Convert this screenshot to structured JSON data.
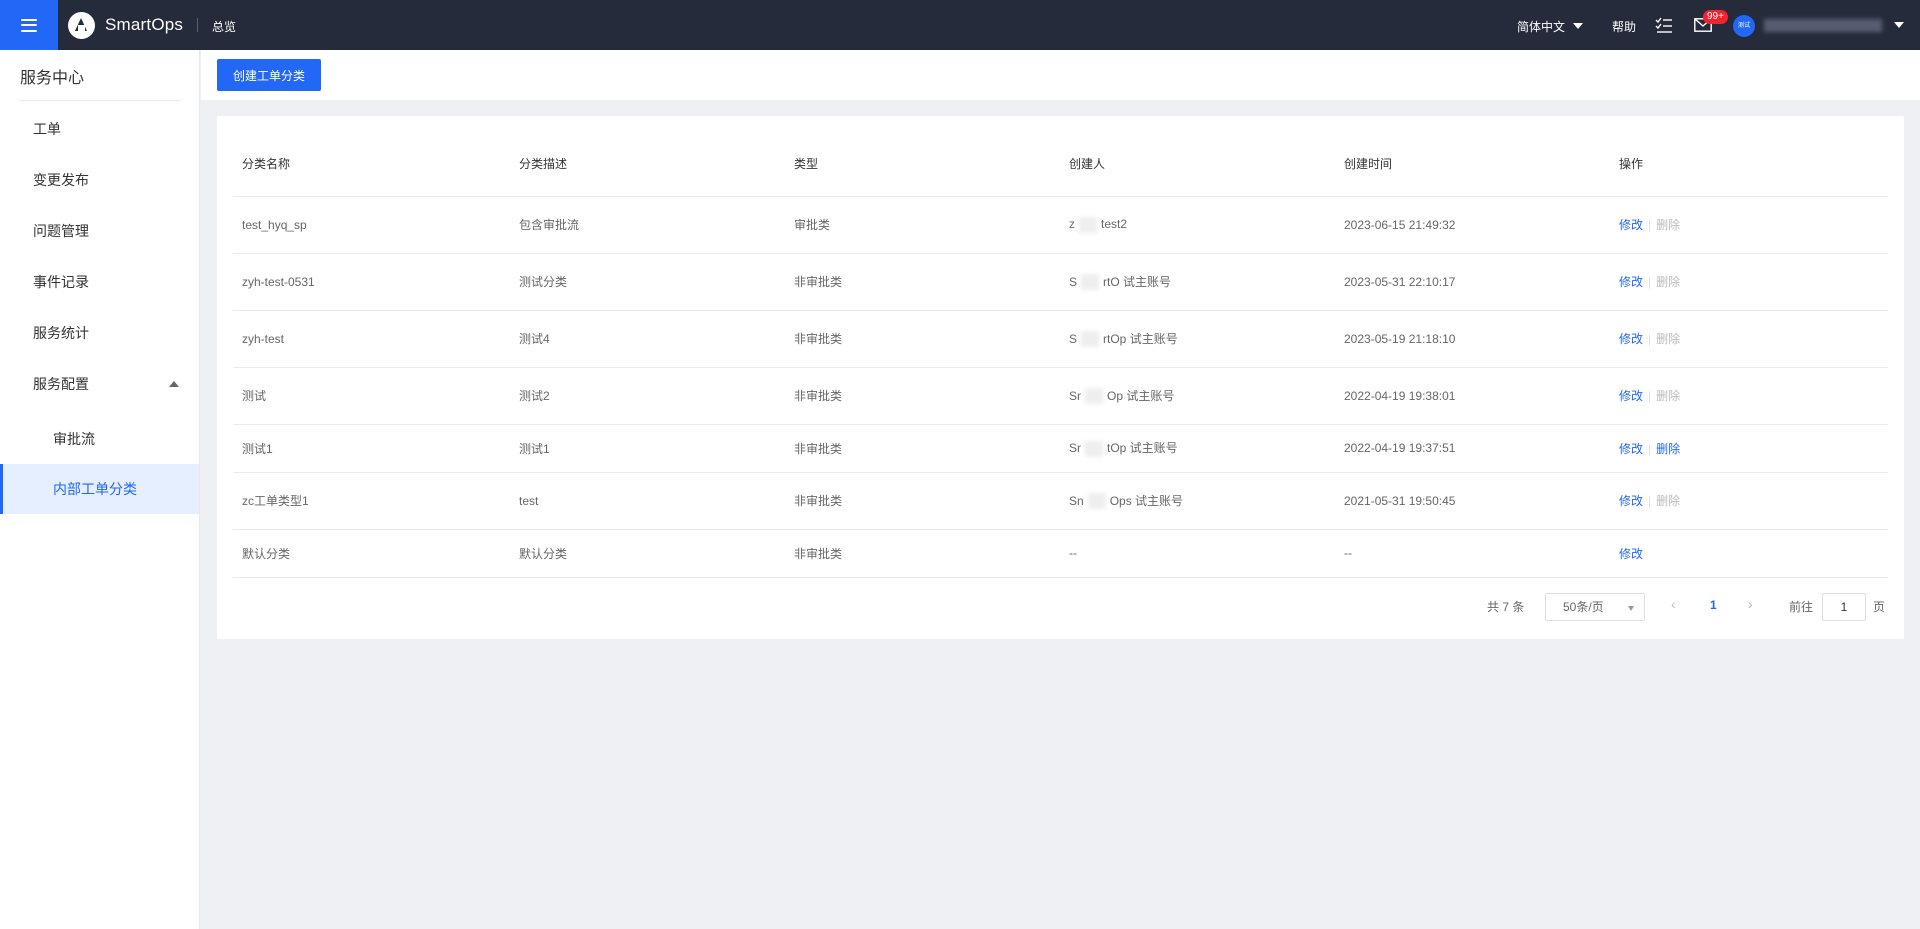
{
  "header": {
    "app_name": "SmartOps",
    "nav_title": "总览",
    "language": "简体中文",
    "help": "帮助",
    "notification_badge": "99+",
    "avatar_text": "测试"
  },
  "sidebar": {
    "title": "服务中心",
    "items": [
      {
        "label": "工单"
      },
      {
        "label": "变更发布"
      },
      {
        "label": "问题管理"
      },
      {
        "label": "事件记录"
      },
      {
        "label": "服务统计"
      },
      {
        "label": "服务配置"
      }
    ],
    "sub_items": [
      {
        "label": "审批流"
      },
      {
        "label": "内部工单分类"
      }
    ]
  },
  "toolbar": {
    "create_label": "创建工单分类"
  },
  "table": {
    "columns": [
      "分类名称",
      "分类描述",
      "类型",
      "创建人",
      "创建时间",
      "操作"
    ],
    "rows": [
      {
        "name": "test_hyq_sp",
        "desc": "包含审批流",
        "type": "审批类",
        "creator_a": "z",
        "creator_b": "test2",
        "time": "2023-06-15 21:49:32",
        "edit": "修改",
        "del": "删除",
        "del_enabled": false
      },
      {
        "name": "zyh-test-0531",
        "desc": "测试分类",
        "type": "非审批类",
        "creator_a": "S",
        "creator_b": "rtO  试主账号",
        "time": "2023-05-31 22:10:17",
        "edit": "修改",
        "del": "删除",
        "del_enabled": false
      },
      {
        "name": "zyh-test",
        "desc": "测试4",
        "type": "非审批类",
        "creator_a": "S",
        "creator_b": "rtOp  试主账号",
        "time": "2023-05-19 21:18:10",
        "edit": "修改",
        "del": "删除",
        "del_enabled": false
      },
      {
        "name": "测试",
        "desc": "测试2",
        "type": "非审批类",
        "creator_a": "Sr",
        "creator_b": "Op  试主账号",
        "time": "2022-04-19 19:38:01",
        "edit": "修改",
        "del": "删除",
        "del_enabled": false
      },
      {
        "name": "测试1",
        "desc": "测试1",
        "type": "非审批类",
        "creator_a": "Sr",
        "creator_b": "tOp  试主账号",
        "time": "2022-04-19 19:37:51",
        "edit": "修改",
        "del": "删除",
        "del_enabled": true
      },
      {
        "name": "zc工单类型1",
        "desc": "test",
        "type": "非审批类",
        "creator_a": "Sn",
        "creator_b": "Ops  试主账号",
        "time": "2021-05-31 19:50:45",
        "edit": "修改",
        "del": "删除",
        "del_enabled": false
      },
      {
        "name": "默认分类",
        "desc": "默认分类",
        "type": "非审批类",
        "creator_a": "--",
        "creator_b": "",
        "time": "--",
        "edit": "修改",
        "del": "",
        "del_enabled": false
      }
    ]
  },
  "pagination": {
    "total": "共 7 条",
    "page_size": "50条/页",
    "current_page": "1",
    "goto_label": "前往",
    "goto_value": "1",
    "page_suffix": "页"
  },
  "colors": {
    "accent": "#2267f5",
    "topbar": "#262b3c",
    "badge": "#f5222d"
  }
}
